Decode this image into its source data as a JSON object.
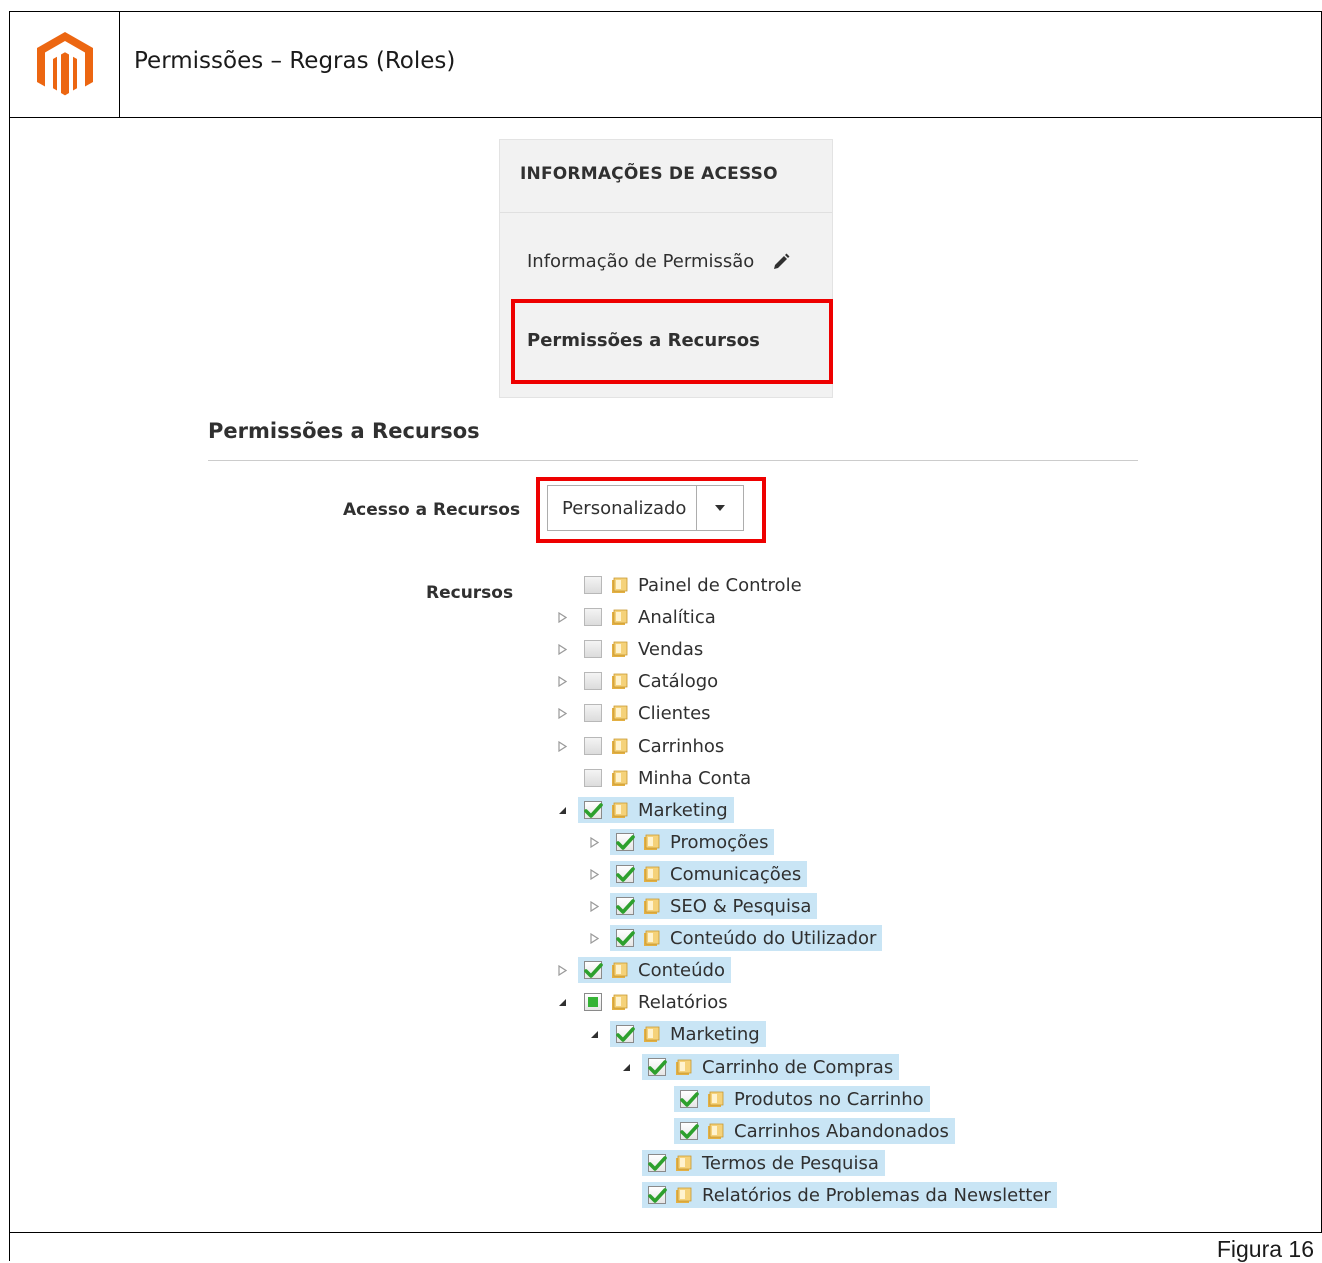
{
  "document": {
    "title": "Permissões – Regras (Roles)",
    "figure_caption": "Figura 16",
    "logo_icon": "magento-logo-icon",
    "brand_color": "#ec6611"
  },
  "access_panel": {
    "title": "INFORMAÇÕES DE ACESSO",
    "tab_info": "Informação de Permissão",
    "tab_info_icon": "pencil-icon",
    "tab_permissions": "Permissões a Recursos"
  },
  "section": {
    "title": "Permissões a Recursos",
    "access_label": "Acesso a Recursos",
    "access_value": "Personalizado",
    "resources_label": "Recursos"
  },
  "tree": [
    {
      "label": "Painel de Controle",
      "level": 0,
      "toggle": "none",
      "state": "unchecked",
      "selected": false
    },
    {
      "label": "Analítica",
      "level": 0,
      "toggle": "collapsed",
      "state": "unchecked",
      "selected": false
    },
    {
      "label": "Vendas",
      "level": 0,
      "toggle": "collapsed",
      "state": "unchecked",
      "selected": false
    },
    {
      "label": "Catálogo",
      "level": 0,
      "toggle": "collapsed",
      "state": "unchecked",
      "selected": false
    },
    {
      "label": "Clientes",
      "level": 0,
      "toggle": "collapsed",
      "state": "unchecked",
      "selected": false
    },
    {
      "label": "Carrinhos",
      "level": 0,
      "toggle": "collapsed",
      "state": "unchecked",
      "selected": false
    },
    {
      "label": "Minha Conta",
      "level": 0,
      "toggle": "none",
      "state": "unchecked",
      "selected": false
    },
    {
      "label": "Marketing",
      "level": 0,
      "toggle": "expanded",
      "state": "checked",
      "selected": true
    },
    {
      "label": "Promoções",
      "level": 1,
      "toggle": "collapsed",
      "state": "checked",
      "selected": true
    },
    {
      "label": "Comunicações",
      "level": 1,
      "toggle": "collapsed",
      "state": "checked",
      "selected": true
    },
    {
      "label": "SEO & Pesquisa",
      "level": 1,
      "toggle": "collapsed",
      "state": "checked",
      "selected": true
    },
    {
      "label": "Conteúdo do Utilizador",
      "level": 1,
      "toggle": "collapsed",
      "state": "checked",
      "selected": true
    },
    {
      "label": "Conteúdo",
      "level": 0,
      "toggle": "collapsed",
      "state": "checked",
      "selected": true
    },
    {
      "label": "Relatórios",
      "level": 0,
      "toggle": "expanded",
      "state": "partial",
      "selected": false
    },
    {
      "label": "Marketing",
      "level": 1,
      "toggle": "expanded",
      "state": "checked",
      "selected": true
    },
    {
      "label": "Carrinho de Compras",
      "level": 2,
      "toggle": "expanded",
      "state": "checked",
      "selected": true
    },
    {
      "label": "Produtos no Carrinho",
      "level": 3,
      "toggle": "none",
      "state": "checked",
      "selected": true
    },
    {
      "label": "Carrinhos Abandonados",
      "level": 3,
      "toggle": "none",
      "state": "checked",
      "selected": true
    },
    {
      "label": "Termos de Pesquisa",
      "level": 2,
      "toggle": "none",
      "state": "checked",
      "selected": true
    },
    {
      "label": "Relatórios de Problemas da Newsletter",
      "level": 2,
      "toggle": "none",
      "state": "checked",
      "selected": true
    }
  ]
}
